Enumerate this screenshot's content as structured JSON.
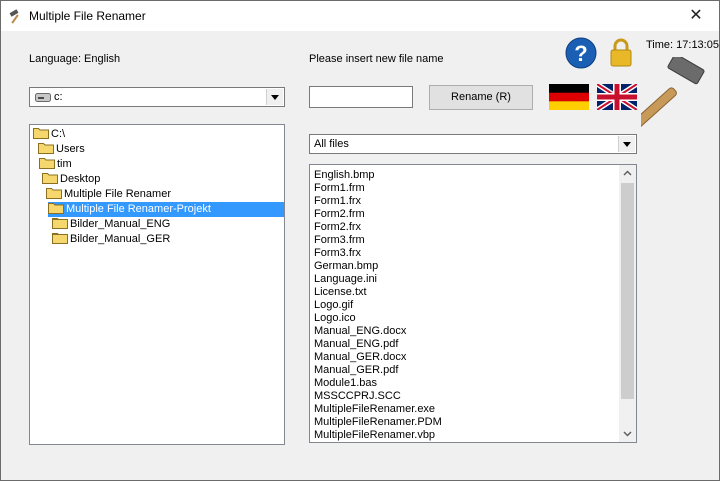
{
  "window": {
    "title": "Multiple File Renamer",
    "close_glyph": "✕"
  },
  "language": {
    "label": "Language: English"
  },
  "drive": {
    "value": "c:"
  },
  "rename": {
    "prompt": "Please insert new file name",
    "input_value": "",
    "button_label": "Rename (R)"
  },
  "time": {
    "text": "Time: 17:13:05"
  },
  "icons": {
    "help": "?",
    "lock": "lock-icon",
    "flag_de": "german-flag-icon",
    "flag_en": "english-flag-icon",
    "hammer": "hammer-icon"
  },
  "filter": {
    "value": "All files"
  },
  "tree": {
    "items": [
      {
        "label": "C:\\",
        "selected": false
      },
      {
        "label": "Users",
        "selected": false
      },
      {
        "label": "tim",
        "selected": false
      },
      {
        "label": "Desktop",
        "selected": false
      },
      {
        "label": "Multiple File Renamer",
        "selected": false
      },
      {
        "label": "Multiple File Renamer-Projekt",
        "selected": true
      },
      {
        "label": "Bilder_Manual_ENG",
        "selected": false
      },
      {
        "label": "Bilder_Manual_GER",
        "selected": false
      }
    ]
  },
  "files": [
    "English.bmp",
    "Form1.frm",
    "Form1.frx",
    "Form2.frm",
    "Form2.frx",
    "Form3.frm",
    "Form3.frx",
    "German.bmp",
    "Language.ini",
    "License.txt",
    "Logo.gif",
    "Logo.ico",
    "Manual_ENG.docx",
    "Manual_ENG.pdf",
    "Manual_GER.docx",
    "Manual_GER.pdf",
    "Module1.bas",
    "MSSCCPRJ.SCC",
    "MultipleFileRenamer.exe",
    "MultipleFileRenamer.PDM",
    "MultipleFileRenamer.vbp"
  ],
  "colors": {
    "selection": "#3399ff",
    "help_blue": "#1a5fb4",
    "lock_gold": "#e8b828"
  }
}
